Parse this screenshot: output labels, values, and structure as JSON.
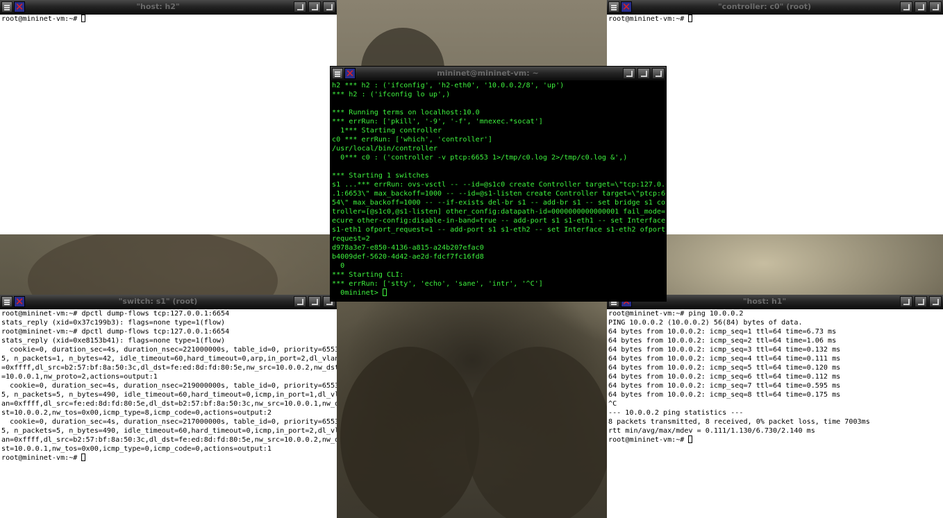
{
  "windows": {
    "host_h2": {
      "title": "\"host: h2\"",
      "lines": [
        "root@mininet-vm:~# "
      ]
    },
    "controller_c0": {
      "title": "\"controller: c0\" (root)",
      "lines": [
        "root@mininet-vm:~# "
      ]
    },
    "mininet_console": {
      "title": "mininet@mininet-vm: ~",
      "lines": [
        "h2 *** h2 : ('ifconfig', 'h2-eth0', '10.0.0.2/8', 'up')",
        "*** h2 : ('ifconfig lo up',)",
        "",
        "*** Running terms on localhost:10.0",
        "*** errRun: ['pkill', '-9', '-f', 'mnexec.*socat']",
        "  1*** Starting controller",
        "c0 *** errRun: ['which', 'controller']",
        "/usr/local/bin/controller",
        "  0*** c0 : ('controller -v ptcp:6653 1>/tmp/c0.log 2>/tmp/c0.log &',)",
        "",
        "*** Starting 1 switches",
        "s1 ...*** errRun: ovs-vsctl -- --id=@s1c0 create Controller target=\\\"tcp:127.0.0",
        ".1:6653\\\" max_backoff=1000 -- --id=@s1-listen create Controller target=\\\"ptcp:66",
        "54\\\" max_backoff=1000 -- --if-exists del-br s1 -- add-br s1 -- set bridge s1 con",
        "troller=[@s1c0,@s1-listen] other_config:datapath-id=0000000000000001 fail_mode=s",
        "ecure other-config:disable-in-band=true -- add-port s1 s1-eth1 -- set Interface",
        "s1-eth1 ofport_request=1 -- add-port s1 s1-eth2 -- set Interface s1-eth2 ofport_",
        "request=2",
        "d978a3e7-e850-4136-a815-a24b207efac0",
        "b4009def-5620-4d42-ae2d-fdcf7fc16fd8",
        "  0",
        "*** Starting CLI:",
        "*** errRun: ['stty', 'echo', 'sane', 'intr', '^C']",
        "  0mininet> "
      ]
    },
    "switch_s1": {
      "title": "\"switch: s1\" (root)",
      "lines": [
        "root@mininet-vm:~# dpctl dump-flows tcp:127.0.0.1:6654",
        "stats_reply (xid=0x37c199b3): flags=none type=1(flow)",
        "root@mininet-vm:~# dpctl dump-flows tcp:127.0.0.1:6654",
        "stats_reply (xid=0xe8153b41): flags=none type=1(flow)",
        "  cookie=0, duration_sec=4s, duration_nsec=221000000s, table_id=0, priority=6553",
        "5, n_packets=1, n_bytes=42, idle_timeout=60,hard_timeout=0,arp,in_port=2,dl_vlan",
        "=0xffff,dl_src=b2:57:bf:8a:50:3c,dl_dst=fe:ed:8d:fd:80:5e,nw_src=10.0.0.2,nw_dst",
        "=10.0.0.1,nw_proto=2,actions=output:1",
        "  cookie=0, duration_sec=4s, duration_nsec=219000000s, table_id=0, priority=6553",
        "5, n_packets=5, n_bytes=490, idle_timeout=60,hard_timeout=0,icmp,in_port=1,dl_vl",
        "an=0xffff,dl_src=fe:ed:8d:fd:80:5e,dl_dst=b2:57:bf:8a:50:3c,nw_src=10.0.0.1,nw_d",
        "st=10.0.0.2,nw_tos=0x00,icmp_type=8,icmp_code=0,actions=output:2",
        "  cookie=0, duration_sec=4s, duration_nsec=217000000s, table_id=0, priority=6553",
        "5, n_packets=5, n_bytes=490, idle_timeout=60,hard_timeout=0,icmp,in_port=2,dl_vl",
        "an=0xffff,dl_src=b2:57:bf:8a:50:3c,dl_dst=fe:ed:8d:fd:80:5e,nw_src=10.0.0.2,nw_d",
        "st=10.0.0.1,nw_tos=0x00,icmp_type=0,icmp_code=0,actions=output:1",
        "root@mininet-vm:~# "
      ]
    },
    "host_h1": {
      "title": "\"host: h1\"",
      "lines": [
        "root@mininet-vm:~# ping 10.0.0.2",
        "PING 10.0.0.2 (10.0.0.2) 56(84) bytes of data.",
        "64 bytes from 10.0.0.2: icmp_seq=1 ttl=64 time=6.73 ms",
        "64 bytes from 10.0.0.2: icmp_seq=2 ttl=64 time=1.06 ms",
        "64 bytes from 10.0.0.2: icmp_seq=3 ttl=64 time=0.132 ms",
        "64 bytes from 10.0.0.2: icmp_seq=4 ttl=64 time=0.111 ms",
        "64 bytes from 10.0.0.2: icmp_seq=5 ttl=64 time=0.120 ms",
        "64 bytes from 10.0.0.2: icmp_seq=6 ttl=64 time=0.112 ms",
        "64 bytes from 10.0.0.2: icmp_seq=7 ttl=64 time=0.595 ms",
        "64 bytes from 10.0.0.2: icmp_seq=8 ttl=64 time=0.175 ms",
        "^C",
        "--- 10.0.0.2 ping statistics ---",
        "8 packets transmitted, 8 received, 0% packet loss, time 7003ms",
        "rtt min/avg/max/mdev = 0.111/1.130/6.730/2.140 ms",
        "root@mininet-vm:~# "
      ]
    }
  },
  "colors": {
    "terminal_green": "#3ef23e",
    "close_x": "#e02222",
    "close_bg": "#2a2f8c",
    "title_text": "#6a6a6a"
  }
}
